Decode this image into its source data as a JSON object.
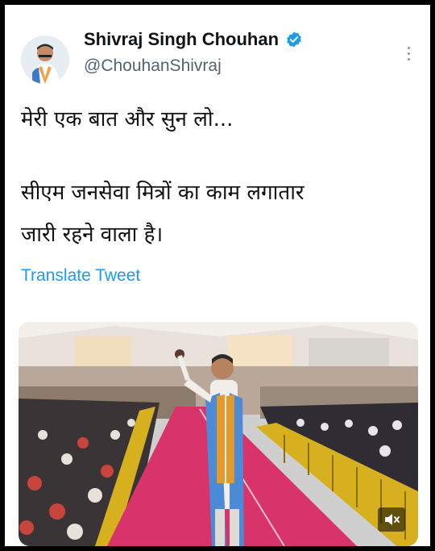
{
  "tweet": {
    "author_name": "Shivraj Singh Chouhan",
    "handle": "@ChouhanShivraj",
    "lines": [
      "मेरी एक बात और सुन लो...",
      "सीएम जनसेवा मित्रों का काम लगातार",
      "जारी रहने वाला है।"
    ],
    "translate_label": "Translate Tweet"
  },
  "icons": {
    "verified": "verified-badge-icon",
    "more": "more-vertical-icon",
    "mute": "speaker-muted-icon"
  },
  "colors": {
    "accent": "#1d9bf0",
    "text": "#0f1419",
    "secondary": "#536471",
    "carpet": "#d8336a",
    "rail": "#d6b01e"
  }
}
